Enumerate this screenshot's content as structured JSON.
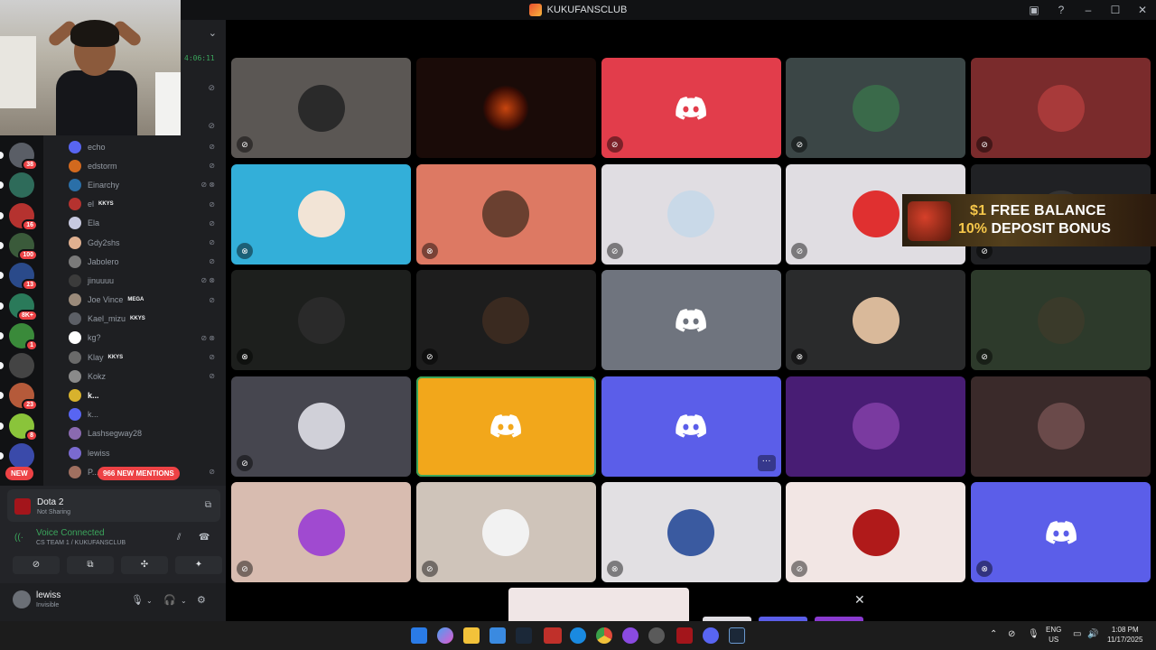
{
  "window": {
    "title": "KUKUFANSCLUB"
  },
  "sidebar": {
    "stream_timer": "4:06:11",
    "users": [
      {
        "name": "echo",
        "color": "#5865f2",
        "bold": false,
        "tag": "",
        "icons": "⊘"
      },
      {
        "name": "edstorm",
        "color": "#d2691e",
        "bold": false,
        "tag": "",
        "icons": "⊘"
      },
      {
        "name": "Einarchy",
        "color": "#2a6fa8",
        "bold": false,
        "tag": "",
        "icons": "⊘ ⊗"
      },
      {
        "name": "el",
        "color": "#b5322f",
        "bold": false,
        "tag": "KKYS",
        "icons": "⊘"
      },
      {
        "name": "Ela",
        "color": "#c7c9e0",
        "bold": false,
        "tag": "",
        "icons": "⊘"
      },
      {
        "name": "Gdy2shs",
        "color": "#e0b090",
        "bold": false,
        "tag": "",
        "icons": "⊘"
      },
      {
        "name": "Jabolero",
        "color": "#7a7a7a",
        "bold": false,
        "tag": "",
        "icons": "⊘"
      },
      {
        "name": "jinuuuu",
        "color": "#3b3b3b",
        "bold": false,
        "tag": "",
        "icons": "⊘ ⊗"
      },
      {
        "name": "Joe Vince",
        "color": "#9a8a7a",
        "bold": false,
        "tag": "MEGA",
        "icons": "⊘"
      },
      {
        "name": "Kael_mizu",
        "color": "#5c5f66",
        "bold": false,
        "tag": "KKYS",
        "icons": ""
      },
      {
        "name": "kg?",
        "color": "#ffffff",
        "bold": false,
        "tag": "",
        "icons": "⊘ ⊗"
      },
      {
        "name": "Klay",
        "color": "#6a6a6a",
        "bold": false,
        "tag": "KKYS",
        "icons": "⊘"
      },
      {
        "name": "Kokz",
        "color": "#8a8a8a",
        "bold": false,
        "tag": "",
        "icons": "⊘"
      },
      {
        "name": "k...",
        "color": "#d8b22d",
        "bold": true,
        "tag": "",
        "icons": ""
      },
      {
        "name": "k...",
        "color": "#5865f2",
        "bold": false,
        "tag": "",
        "icons": ""
      },
      {
        "name": "Lashsegway28",
        "color": "#8a6ab0",
        "bold": false,
        "tag": "",
        "icons": ""
      },
      {
        "name": "lewiss",
        "color": "#7a6ad0",
        "bold": false,
        "tag": "",
        "icons": ""
      },
      {
        "name": "P...",
        "color": "#a07060",
        "bold": false,
        "tag": "",
        "icons": "⊘"
      }
    ],
    "mentions_label": "966 NEW MENTIONS",
    "new_label": "NEW"
  },
  "servers": [
    {
      "badge": "38",
      "color": "#5a5e66"
    },
    {
      "badge": "",
      "color": "#2e6b5a"
    },
    {
      "badge": "16",
      "color": "#b5322f"
    },
    {
      "badge": "100",
      "color": "#3a5a3a"
    },
    {
      "badge": "13",
      "color": "#2a4a8a"
    },
    {
      "badge": "8K+",
      "color": "#2a7a5a"
    },
    {
      "badge": "1",
      "color": "#3a8a3a"
    },
    {
      "badge": "",
      "color": "#444"
    },
    {
      "badge": "23",
      "color": "#b55a3a"
    },
    {
      "badge": "8",
      "color": "#8ac43a"
    },
    {
      "badge": "",
      "color": "#3a4aaa"
    }
  ],
  "activity": {
    "title": "Dota 2",
    "subtitle": "Not Sharing"
  },
  "voice": {
    "status": "Voice Connected",
    "channel": "CS TEAM 1 / KUKUFANSCLUB"
  },
  "user": {
    "name": "lewiss",
    "status": "Invisible"
  },
  "ad": {
    "line1_prefix": "$1",
    "line1_rest": " FREE BALANCE",
    "line2_prefix": "10%",
    "line2_rest": " DEPOSIT BONUS"
  },
  "tiles": [
    {
      "bg": "#5b5754",
      "kind": "avatar",
      "avatar": "#2a2a2a",
      "mic": "⊘"
    },
    {
      "bg": "#1a0b08",
      "kind": "letter",
      "avatar": "#c8450f",
      "mic": ""
    },
    {
      "bg": "#e23d4b",
      "kind": "discord",
      "avatar": "",
      "mic": "⊘"
    },
    {
      "bg": "#3b4646",
      "kind": "avatar",
      "avatar": "#3a6a4a",
      "mic": "⊘"
    },
    {
      "bg": "#7a2b2c",
      "kind": "avatar",
      "avatar": "#a83a3a",
      "mic": "⊘"
    },
    {
      "bg": "#33afd9",
      "kind": "avatar",
      "avatar": "#f2e4d6",
      "mic": "⊗"
    },
    {
      "bg": "#dd7963",
      "kind": "avatar",
      "avatar": "#6a4030",
      "mic": "⊗"
    },
    {
      "bg": "#e0dde2",
      "kind": "avatar",
      "avatar": "#c9d9e8",
      "mic": "⊘"
    },
    {
      "bg": "#e0dde2",
      "kind": "avatar",
      "avatar": "#e03030",
      "mic": "⊘"
    },
    {
      "bg": "#202124",
      "kind": "avatar",
      "avatar": "#333",
      "mic": "⊘"
    },
    {
      "bg": "#1d1f1d",
      "kind": "avatar",
      "avatar": "#2a2a2a",
      "mic": "⊗"
    },
    {
      "bg": "#1d1d1d",
      "kind": "avatar",
      "avatar": "#3a2a20",
      "mic": "⊘"
    },
    {
      "bg": "#6f747e",
      "kind": "discord",
      "avatar": "",
      "mic": ""
    },
    {
      "bg": "#2a2b2c",
      "kind": "avatar",
      "avatar": "#d9b99a",
      "mic": "⊗"
    },
    {
      "bg": "#2d3a2b",
      "kind": "avatar",
      "avatar": "#3a3a2a",
      "mic": "⊘"
    },
    {
      "bg": "#46464f",
      "kind": "avatar",
      "avatar": "#d0d0d8",
      "mic": "⊘"
    },
    {
      "bg": "#f2a71b",
      "kind": "discord",
      "avatar": "",
      "mic": "",
      "selected": true
    },
    {
      "bg": "#5b5ee9",
      "kind": "discord",
      "avatar": "",
      "mic": "",
      "more": "···"
    },
    {
      "bg": "#481d74",
      "kind": "avatar",
      "avatar": "#7a3aa0",
      "mic": ""
    },
    {
      "bg": "#3a2a2a",
      "kind": "avatar",
      "avatar": "#6a4a4a",
      "mic": ""
    },
    {
      "bg": "#d8bcb0",
      "kind": "avatar",
      "avatar": "#a04ad0",
      "mic": "⊘"
    },
    {
      "bg": "#cfc4ba",
      "kind": "avatar",
      "avatar": "#f2f2f2",
      "mic": "⊘"
    },
    {
      "bg": "#e2e0e3",
      "kind": "avatar",
      "avatar": "#3a5aa0",
      "mic": "⊗"
    },
    {
      "bg": "#f2e6e4",
      "kind": "avatar",
      "avatar": "#b01a1a",
      "mic": "⊘"
    },
    {
      "bg": "#5b5ee9",
      "kind": "discord",
      "avatar": "",
      "mic": "⊗"
    }
  ],
  "taskbar": {
    "lang_line1": "ENG",
    "lang_line2": "US",
    "time": "1:08 PM",
    "date": "11/17/2025"
  }
}
